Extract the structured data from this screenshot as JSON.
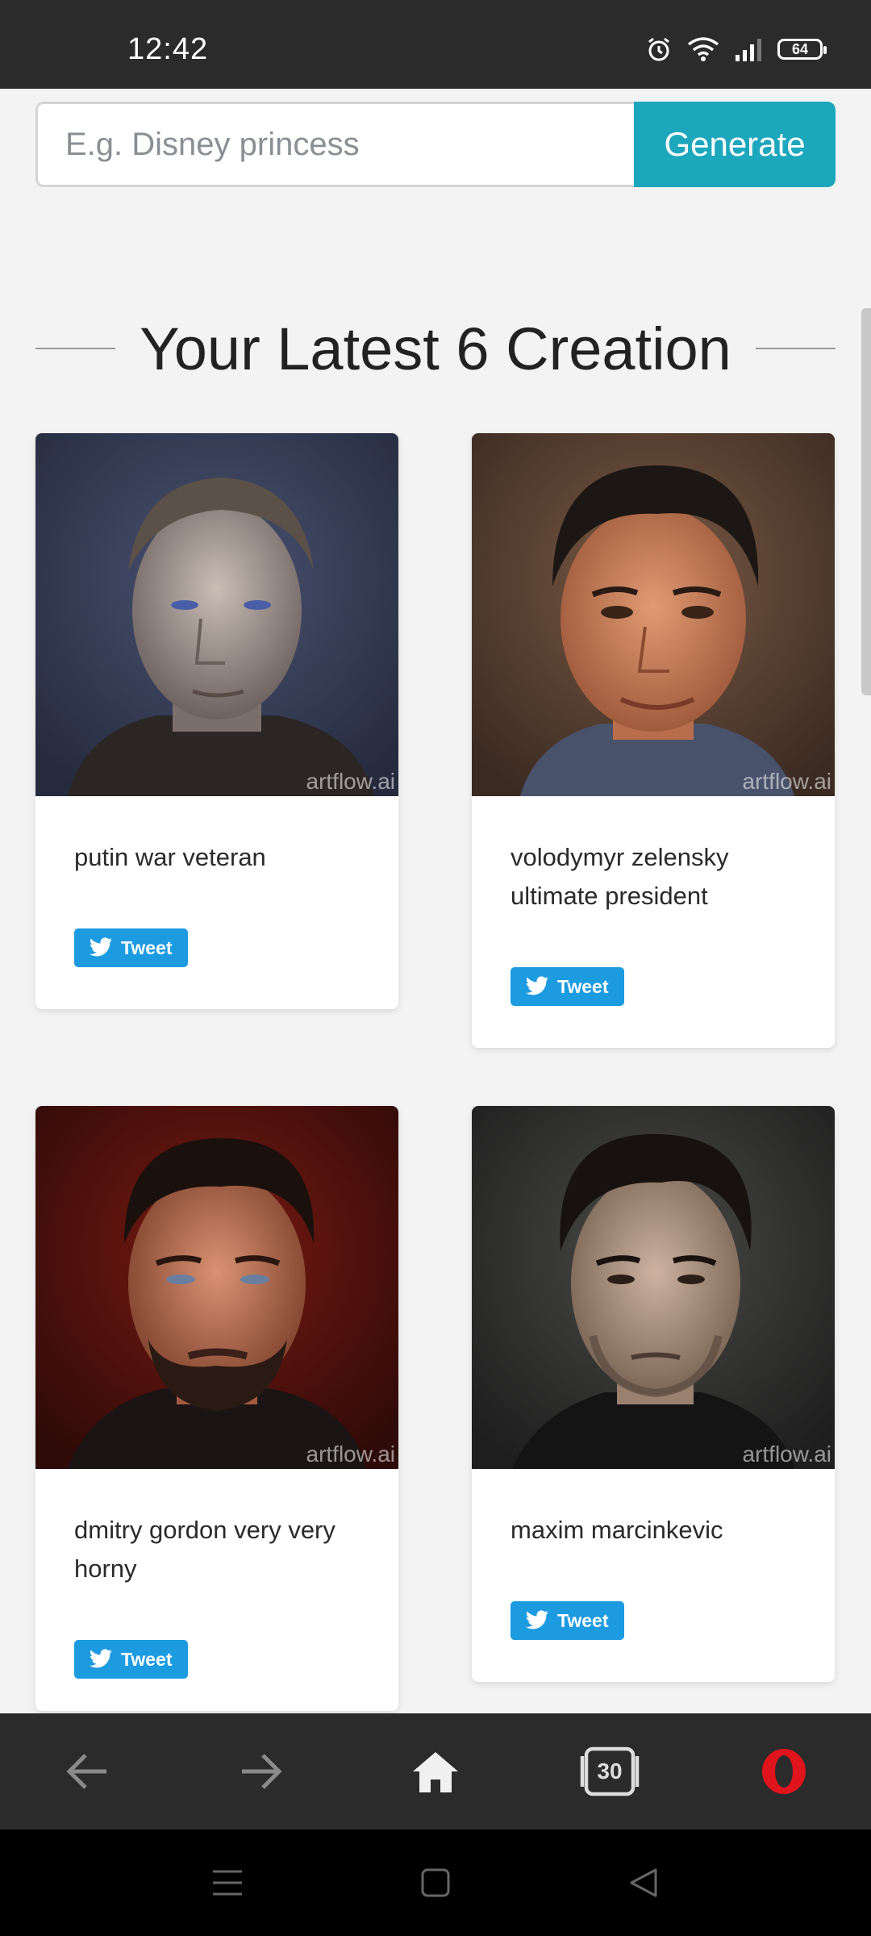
{
  "status_bar": {
    "time": "12:42",
    "battery": "64"
  },
  "search": {
    "placeholder": "E.g. Disney princess",
    "value": "",
    "button_label": "Generate"
  },
  "heading": "Your Latest 6 Creation",
  "cards": [
    {
      "caption": "putin war veteran",
      "watermark": "artflow.ai",
      "tweet_label": "Tweet"
    },
    {
      "caption": "volodymyr zelensky ultimate president",
      "watermark": "artflow.ai",
      "tweet_label": "Tweet"
    },
    {
      "caption": "dmitry gordon very very horny",
      "watermark": "artflow.ai",
      "tweet_label": "Tweet"
    },
    {
      "caption": "maxim marcinkevic",
      "watermark": "artflow.ai",
      "tweet_label": "Tweet"
    }
  ],
  "browser_bar": {
    "tabs_count": "30"
  },
  "colors": {
    "accent": "#1da7bd",
    "tweet": "#1d9be0",
    "opera": "#e0141d"
  }
}
